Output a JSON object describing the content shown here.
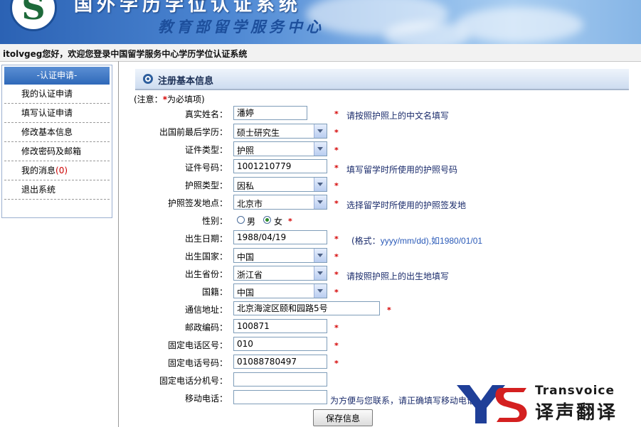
{
  "header": {
    "system_title": "国外学历学位认证系统",
    "org_title": "教育部留学服务中心"
  },
  "welcome": "itolvgeg您好，欢迎您登录中国留学服务中心学历学位认证系统",
  "sidebar": {
    "heading": "-认证申请-",
    "items": [
      {
        "label": "我的认证申请"
      },
      {
        "label": "填写认证申请"
      },
      {
        "label": "修改基本信息"
      },
      {
        "label": "修改密码及邮箱"
      },
      {
        "label": "我的消息",
        "count": "(0)"
      },
      {
        "label": "退出系统"
      }
    ]
  },
  "panel": {
    "title": "注册基本信息",
    "note_prefix": "(注意：",
    "note_star": "*",
    "note_suffix": "为必填项)"
  },
  "form": {
    "real_name": {
      "label": "真实姓名：",
      "value": "潘婷",
      "hint": "请按照护照上的中文名填写"
    },
    "degree": {
      "label": "出国前最后学历：",
      "value": "硕士研究生"
    },
    "id_type": {
      "label": "证件类型：",
      "value": "护照"
    },
    "id_number": {
      "label": "证件号码：",
      "value": "1001210779",
      "hint": "填写留学时所使用的护照号码"
    },
    "passport_type": {
      "label": "护照类型：",
      "value": "因私"
    },
    "passport_place": {
      "label": "护照签发地点：",
      "value": "北京市",
      "hint": "选择留学时所使用的护照签发地"
    },
    "gender": {
      "label": "性别：",
      "male": "男",
      "female": "女",
      "selected": "female"
    },
    "birth_date": {
      "label": "出生日期：",
      "value": "1988/04/19",
      "hint_prefix": "(格式：",
      "hint_format": "yyyy/mm/dd),如1980/01/01"
    },
    "birth_country": {
      "label": "出生国家：",
      "value": "中国"
    },
    "birth_province": {
      "label": "出生省份：",
      "value": "浙江省",
      "hint": "请按照护照上的出生地填写"
    },
    "nationality": {
      "label": "国籍：",
      "value": "中国"
    },
    "address": {
      "label": "通信地址：",
      "value": "北京海淀区颐和园路5号"
    },
    "postcode": {
      "label": "邮政编码：",
      "value": "100871"
    },
    "area_code": {
      "label": "固定电话区号：",
      "value": "010"
    },
    "phone": {
      "label": "固定电话号码：",
      "value": "01088780497"
    },
    "extension": {
      "label": "固定电话分机号：",
      "value": ""
    },
    "mobile": {
      "label": "移动电话：",
      "value": "",
      "hint": "为方便与您联系，请正确填写移动电话"
    },
    "required_mark": "*"
  },
  "save_button": "保存信息",
  "watermark": {
    "logo_letters": "YS",
    "brand_en": "Transvoice",
    "brand_cn": "译声翻译",
    "colors": {
      "blue": "#1f3f98",
      "red": "#d42020"
    }
  }
}
